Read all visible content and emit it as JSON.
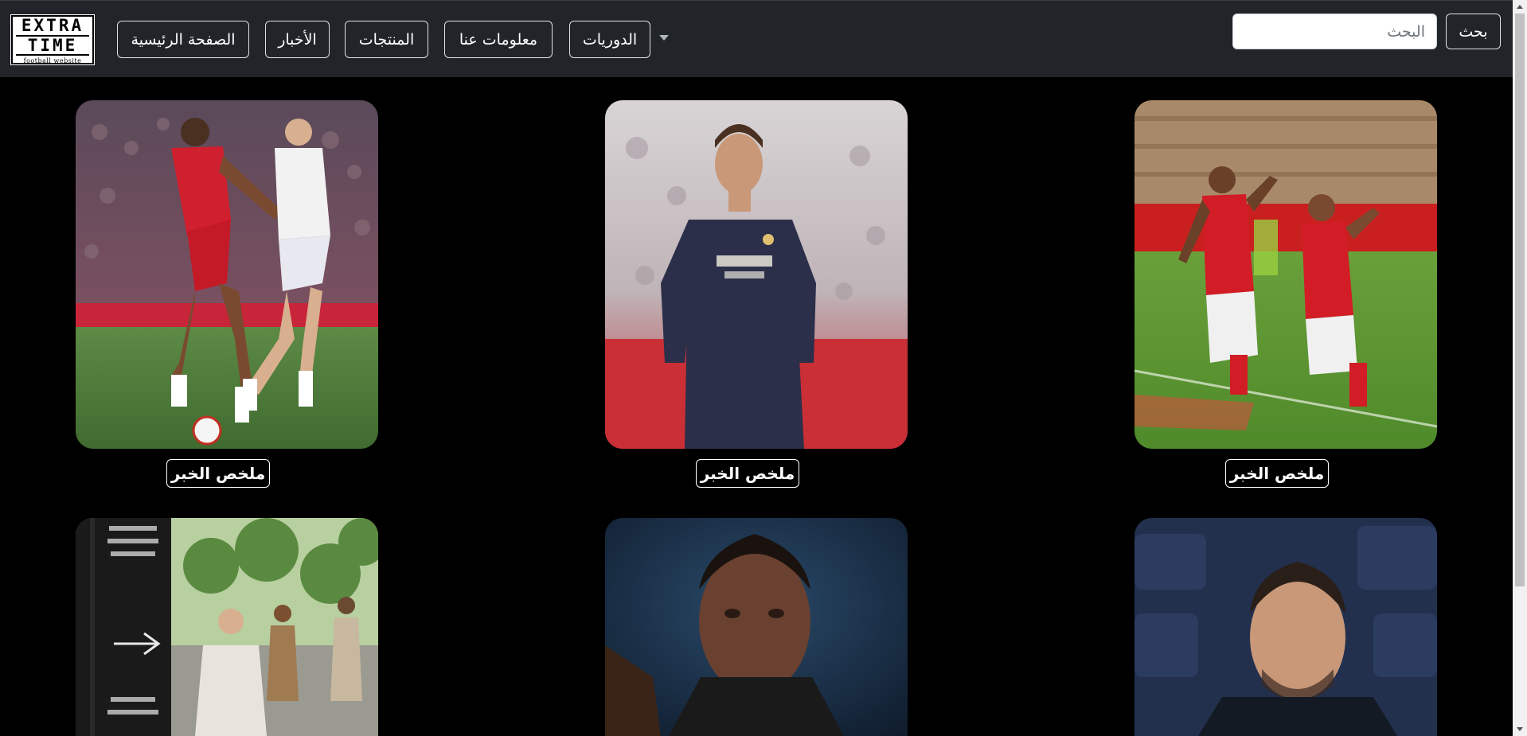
{
  "logo": {
    "line1": "EXTRA",
    "line2": "TIME",
    "tagline": "football website"
  },
  "nav": {
    "home": "الصفحة الرئيسية",
    "news": "الأخبار",
    "products": "المنتجات",
    "about": "معلومات عنا",
    "leagues": "الدوريات"
  },
  "search": {
    "placeholder": "البحث",
    "button": "بحث"
  },
  "cards": [
    {
      "button": "ملخص الخبر",
      "image": "liverpool-vs-tottenham-match-photo"
    },
    {
      "button": "ملخص الخبر",
      "image": "real-madrid-player-photo"
    },
    {
      "button": "ملخص الخبر",
      "image": "al-ahly-players-celebrating-photo"
    },
    {
      "image": "street-scene-photo"
    },
    {
      "image": "player-portrait-photo"
    },
    {
      "image": "coach-in-stands-photo"
    }
  ],
  "colors": {
    "navbar": "#212529",
    "background": "#000000",
    "accent": "#ffffff"
  }
}
